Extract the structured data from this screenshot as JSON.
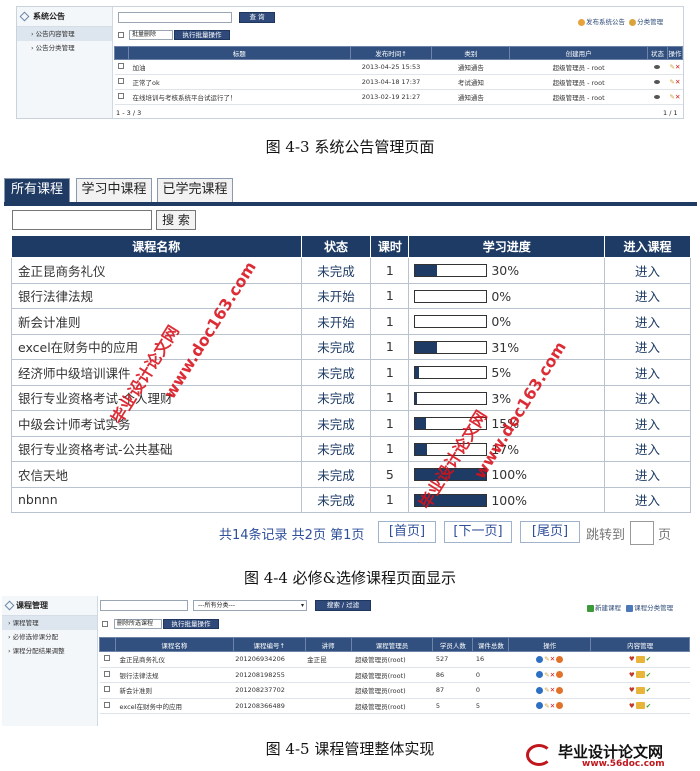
{
  "fig1": {
    "sidebar_title": "系统公告",
    "sidebar_items": [
      "公告内容管理",
      "公告分类管理"
    ],
    "search_button": "查 询",
    "batch_select": "批量删除",
    "batch_button": "执行批量操作",
    "top_links": [
      "发布系统公告",
      "分类管理"
    ],
    "headers": [
      "",
      "标题",
      "发布时间↑",
      "类别",
      "创建用户",
      "状态",
      "操作"
    ],
    "rows": [
      [
        "加油",
        "2013-04-25 15:53",
        "通知通告",
        "超级管理员 - root"
      ],
      [
        "正常了ok",
        "2013-04-18 17:37",
        "考试通知",
        "超级管理员 - root"
      ],
      [
        "在线培训与考核系统平台试运行了！",
        "2013-02-19 21:27",
        "通知通告",
        "超级管理员 - root"
      ]
    ],
    "pager_left": "1 - 3 / 3",
    "pager_right": "1 / 1"
  },
  "caption1": "图 4-3   系统公告管理页面",
  "fig2": {
    "tabs": [
      "所有课程",
      "学习中课程",
      "已学完课程"
    ],
    "search_button": "搜 索",
    "headers": [
      "课程名称",
      "状态",
      "课时",
      "学习进度",
      "进入课程"
    ],
    "rows": [
      {
        "name": "金正昆商务礼仪",
        "status": "未完成",
        "hours": "1",
        "progress": 30,
        "label": "30%",
        "enter": "进入"
      },
      {
        "name": "银行法律法规",
        "status": "未开始",
        "hours": "1",
        "progress": 0,
        "label": "0%",
        "enter": "进入"
      },
      {
        "name": "新会计准则",
        "status": "未开始",
        "hours": "1",
        "progress": 0,
        "label": "0%",
        "enter": "进入"
      },
      {
        "name": "excel在财务中的应用",
        "status": "未完成",
        "hours": "1",
        "progress": 31,
        "label": "31%",
        "enter": "进入"
      },
      {
        "name": "经济师中级培训课件",
        "status": "未完成",
        "hours": "1",
        "progress": 5,
        "label": "5%",
        "enter": "进入"
      },
      {
        "name": "银行专业资格考试-个人理财",
        "status": "未完成",
        "hours": "1",
        "progress": 3,
        "label": "3%",
        "enter": "进入"
      },
      {
        "name": "中级会计师考试实务",
        "status": "未完成",
        "hours": "1",
        "progress": 15,
        "label": "15%",
        "enter": "进入"
      },
      {
        "name": "银行专业资格考试-公共基础",
        "status": "未完成",
        "hours": "1",
        "progress": 17,
        "label": "17%",
        "enter": "进入"
      },
      {
        "name": "农信天地",
        "status": "未完成",
        "hours": "5",
        "progress": 100,
        "label": "100%",
        "enter": "进入"
      },
      {
        "name": "nbnnn",
        "status": "未完成",
        "hours": "1",
        "progress": 100,
        "label": "100%",
        "enter": "进入"
      }
    ],
    "pager_info": "共14条记录  共2页   第1页",
    "pager_buttons": [
      "[首页]",
      "[下一页]",
      "[尾页]"
    ],
    "jump_label": "跳转到",
    "page_unit": "页"
  },
  "caption2": "图 4-4  必修&选修课程页面显示",
  "fig3": {
    "sidebar_title": "课程管理",
    "sidebar_items": [
      "课程管理",
      "必修选修课分配",
      "课程分配结果调整"
    ],
    "category_select": "---所有分类---",
    "search_button": "搜索 / 过滤",
    "batch_select": "删除所选课程",
    "batch_button": "执行批量操作",
    "top_links": [
      "新建课程",
      "课程分类管理"
    ],
    "headers": [
      "",
      "课程名称",
      "课程编号↑",
      "讲师",
      "课程管理员",
      "学员人数",
      "课件总数",
      "操作",
      "内容管理"
    ],
    "rows": [
      [
        "金正昆商务礼仪",
        "201206934206",
        "金正昆",
        "超级管理员(root)",
        "527",
        "16"
      ],
      [
        "银行法律法规",
        "201208198255",
        "",
        "超级管理员(root)",
        "86",
        "0"
      ],
      [
        "新会计准则",
        "201208237702",
        "",
        "超级管理员(root)",
        "87",
        "0"
      ],
      [
        "excel在财务中的应用",
        "201208366489",
        "",
        "超级管理员(root)",
        "5",
        "5"
      ]
    ]
  },
  "caption3": "图 4-5 课程管理整体实现",
  "watermarks": [
    "毕业设计论文网",
    "www.doc163.com",
    "毕业设计论文网",
    "www.doc163.com"
  ],
  "corner_logo": {
    "title": "毕业设计论文网",
    "url": "www.56doc.com"
  }
}
